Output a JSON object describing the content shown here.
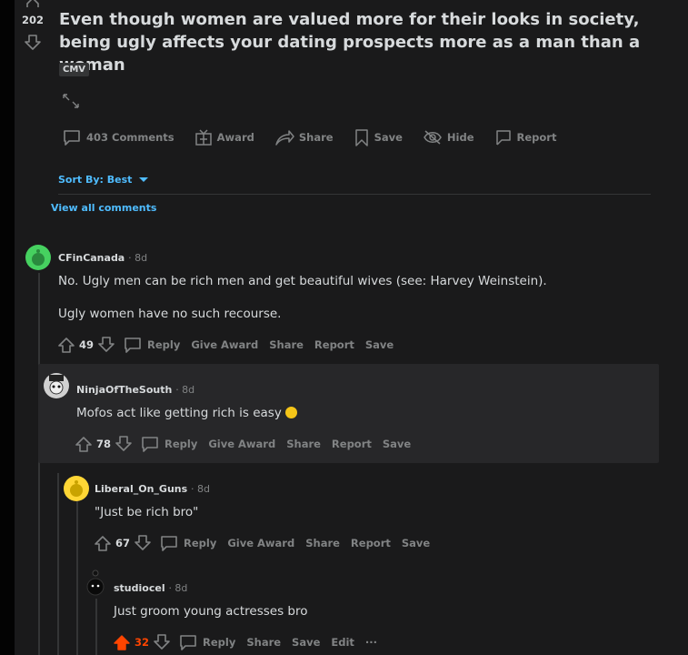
{
  "post": {
    "score": "202",
    "title": "Even though women are valued more for their looks in society, being ugly affects your dating prospects more as a man than a woman",
    "flair": "CMV",
    "actions": {
      "comments": "403 Comments",
      "award": "Award",
      "share": "Share",
      "save": "Save",
      "hide": "Hide",
      "report": "Report"
    }
  },
  "sort_label": "Sort By: Best",
  "view_all": "View all comments",
  "comments": [
    {
      "author": "CFinCanada",
      "time": "· 8d",
      "lines": [
        "No. Ugly men can be rich men and get beautiful wives (see: Harvey Weinstein).",
        "Ugly women have no such recourse."
      ],
      "score": "49",
      "actions": [
        "Reply",
        "Give Award",
        "Share",
        "Report",
        "Save"
      ],
      "avatar_color": "#46d160"
    },
    {
      "author": "NinjaOfTheSouth",
      "time": "· 8d",
      "lines": [
        "Mofos act like getting rich is easy"
      ],
      "score": "78",
      "actions": [
        "Reply",
        "Give Award",
        "Share",
        "Report",
        "Save"
      ],
      "avatar_color": "#d0d0d0"
    },
    {
      "author": "Liberal_On_Guns",
      "time": "· 8d",
      "lines": [
        "\"Just be rich bro\""
      ],
      "score": "67",
      "actions": [
        "Reply",
        "Give Award",
        "Share",
        "Report",
        "Save"
      ],
      "avatar_color": "#ffd635"
    },
    {
      "author": "studiocel",
      "time": "· 8d",
      "lines": [
        "Just groom young actresses bro"
      ],
      "score": "32",
      "actions": [
        "Reply",
        "Share",
        "Save",
        "Edit",
        "···"
      ],
      "avatar_color": "#1a1a1b"
    }
  ],
  "colors": {
    "upvoted": "#ff4500",
    "link": "#4fbcff",
    "muted": "#818384"
  }
}
